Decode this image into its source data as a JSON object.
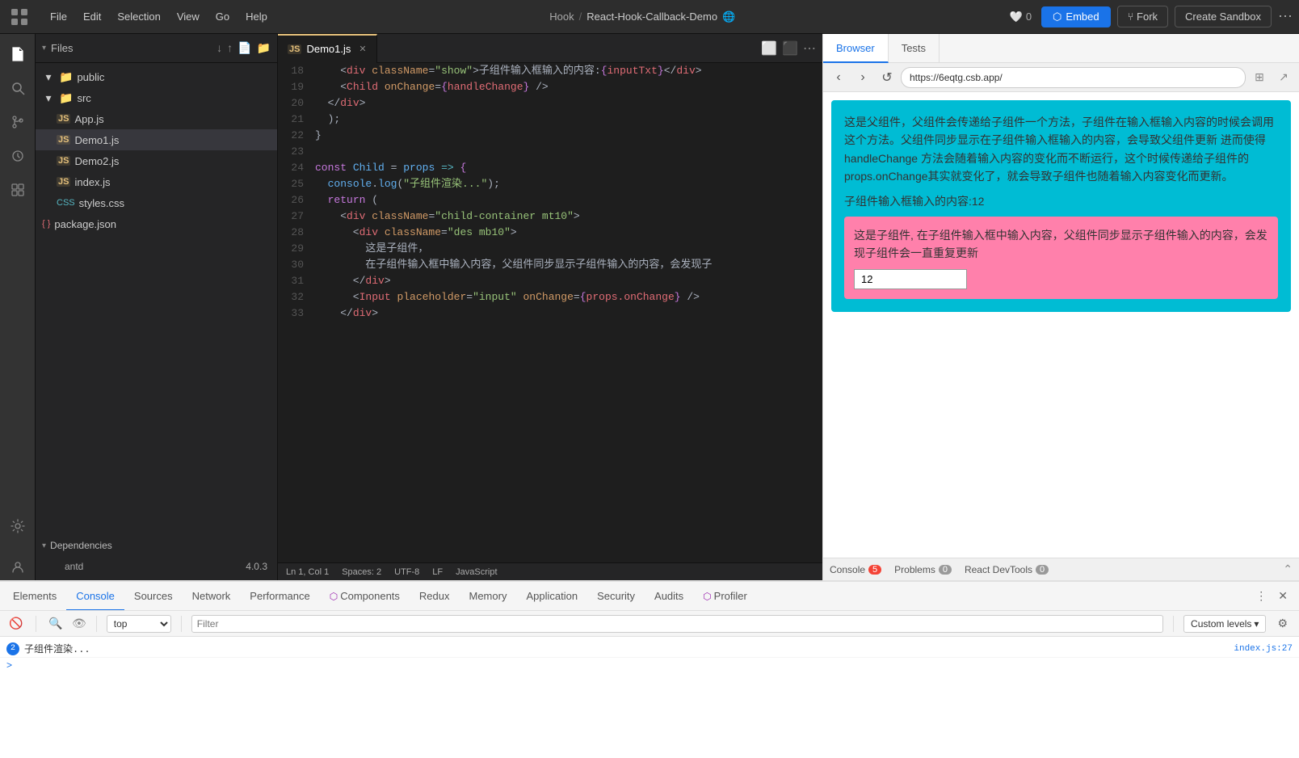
{
  "topMenu": {
    "logo": "grid-icon",
    "items": [
      "File",
      "Edit",
      "Selection",
      "View",
      "Go",
      "Help"
    ],
    "breadcrumb": {
      "part1": "Hook",
      "sep": "/",
      "part2": "React-Hook-Callback-Demo",
      "globe": "🌐"
    },
    "heartCount": "0",
    "embedLabel": "Embed",
    "forkLabel": "Fork",
    "sandboxLabel": "Create Sandbox"
  },
  "sidebar": {
    "title": "Files",
    "collapseIcon": "▾",
    "sortDownIcon": "↓",
    "sortUpIcon": "↑",
    "newFileIcon": "📄",
    "newFolderIcon": "📁",
    "tree": [
      {
        "name": "public",
        "type": "folder",
        "indent": 0
      },
      {
        "name": "src",
        "type": "folder",
        "indent": 0
      },
      {
        "name": "App.js",
        "type": "js",
        "indent": 1
      },
      {
        "name": "Demo1.js",
        "type": "js",
        "indent": 1,
        "active": true
      },
      {
        "name": "Demo2.js",
        "type": "js",
        "indent": 1
      },
      {
        "name": "index.js",
        "type": "js",
        "indent": 1
      },
      {
        "name": "styles.css",
        "type": "css",
        "indent": 1
      },
      {
        "name": "package.json",
        "type": "json",
        "indent": 0
      }
    ],
    "dependencies": {
      "label": "Dependencies",
      "items": [
        {
          "name": "antd",
          "version": "4.0.3"
        }
      ]
    },
    "bottomLabel": ""
  },
  "editor": {
    "tabs": [
      {
        "name": "Demo1.js",
        "type": "js",
        "active": true
      }
    ],
    "lines": [
      {
        "num": "18",
        "content": "    <div className=\"show\">子组件输入框输入的内容:{inputTxt}</div>"
      },
      {
        "num": "19",
        "content": "    <Child onChange={handleChange} />"
      },
      {
        "num": "20",
        "content": "  </div>"
      },
      {
        "num": "21",
        "content": "  );"
      },
      {
        "num": "22",
        "content": "}"
      },
      {
        "num": "23",
        "content": ""
      },
      {
        "num": "24",
        "content": "const Child = props => {"
      },
      {
        "num": "25",
        "content": "  console.log(\"子组件渲染...\");"
      },
      {
        "num": "26",
        "content": "  return ("
      },
      {
        "num": "27",
        "content": "    <div className=\"child-container mt10\">"
      },
      {
        "num": "28",
        "content": "      <div className=\"des mb10\">"
      },
      {
        "num": "29",
        "content": "        这是子组件，"
      },
      {
        "num": "30",
        "content": "        在子组件输入框中输入内容，父组件同步显示子组件输入的内容，会发现子"
      },
      {
        "num": "31",
        "content": "      </div>"
      },
      {
        "num": "32",
        "content": "      <Input placeholder=\"input\" onChange={props.onChange} />"
      },
      {
        "num": "33",
        "content": "    </div>"
      }
    ]
  },
  "browser": {
    "tabs": [
      "Browser",
      "Tests"
    ],
    "activeTab": "Browser",
    "url": "https://6eqtg.csb.app/",
    "preview": {
      "parentText": "这是父组件，父组件会传递给子组件一个方法，子组件在输入框输入内容的时候会调用这个方法。父组件同步显示在子组件输入框输入的内容，会导致父组件更新 进而使得handleChange 方法会随着输入内容的变化而不断运行，这个时候传递给子组件的 props.onChange其实就变化了，就会导致子组件也随着输入内容变化而更新。",
      "parentInputValue": "子组件输入框输入的内容:12",
      "childTitle": "这是子组件, 在子组件输入框中输入内容，父组件同步显示子组件输入的内容，会发现子组件会一直重复更新",
      "inputValue": "12"
    },
    "devtoolsTabs": [
      {
        "name": "Console",
        "badge": "5",
        "badgeType": "red"
      },
      {
        "name": "Problems",
        "badge": "0",
        "badgeType": "gray"
      },
      {
        "name": "React DevTools",
        "badge": "0",
        "badgeType": "gray"
      }
    ]
  },
  "devtools": {
    "tabs": [
      "Elements",
      "Console",
      "Sources",
      "Network",
      "Performance",
      "Components",
      "Redux",
      "Memory",
      "Application",
      "Security",
      "Audits",
      "Profiler"
    ],
    "activeTab": "Console",
    "toolbar": {
      "contextLabel": "top",
      "filterPlaceholder": "Filter",
      "levelLabel": "Custom levels"
    },
    "console": [
      {
        "type": "log",
        "badge": "2",
        "text": "子组件渲染...",
        "source": "index.js:27"
      }
    ],
    "arrowLine": ">"
  },
  "statusBar": {
    "ln": "Ln 1, Col 1",
    "spaces": "Spaces: 2",
    "encoding": "UTF-8",
    "lineEnding": "LF",
    "language": "JavaScript"
  }
}
